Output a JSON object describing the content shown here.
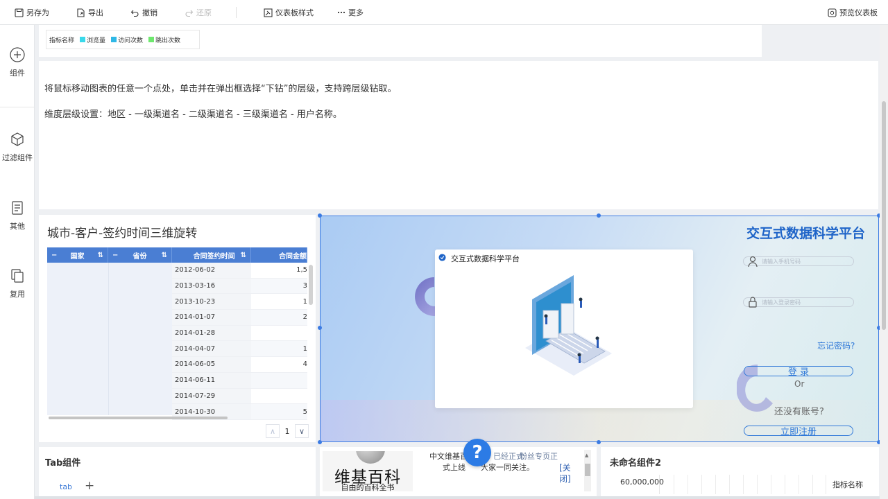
{
  "toolbar": {
    "save_as": "另存为",
    "export": "导出",
    "undo": "撤销",
    "redo": "还原",
    "dashboard_style": "仪表板样式",
    "more": "更多",
    "preview": "预览仪表板"
  },
  "sidebar": {
    "items": [
      {
        "label": "组件",
        "icon": "plus-circle-icon"
      },
      {
        "label": "过滤组件",
        "icon": "cube-icon"
      },
      {
        "label": "其他",
        "icon": "document-icon"
      },
      {
        "label": "复用",
        "icon": "copy-icon"
      }
    ]
  },
  "legend_panel": {
    "title": "指标名称",
    "items": [
      {
        "label": "浏览量",
        "color": "#3ad9ea"
      },
      {
        "label": "访问次数",
        "color": "#2fb8e6"
      },
      {
        "label": "跳出次数",
        "color": "#6ee86e"
      }
    ]
  },
  "text_panel": {
    "line1": "将鼠标移动图表的任意一个点处，单击并在弹出框选择“下钻”的层级，支持跨层级钻取。",
    "line2": "维度层级设置：地区 - 一级渠道名 - 二级渠道名 - 三级渠道名 - 用户名称。"
  },
  "table_widget": {
    "title": "城市-客户-签约时间三维旋转",
    "headers": [
      "国家",
      "省份",
      "合同签约时间",
      "合同金额"
    ],
    "collapse_symbol": "−",
    "sort_symbol": "⇅",
    "dates": [
      "2012-06-02",
      "2013-03-16",
      "2013-10-23",
      "2014-01-07",
      "2014-01-28",
      "2014-04-07",
      "2014-06-05",
      "2014-06-11",
      "2014-07-29",
      "2014-10-30"
    ],
    "amounts": [
      "1,5",
      "3",
      "1",
      "2",
      "",
      "1",
      "4",
      "",
      "",
      "5"
    ],
    "page": "1",
    "prev": "∧",
    "next": "∨"
  },
  "image_panel": {
    "dialog_title": "交互式数据科学平台",
    "brand_title": "交互式数据科学平台",
    "username_placeholder": "请输入手机号码",
    "password_placeholder": "请输入登录密码",
    "forgot": "忘记密码?",
    "login": "登 录",
    "or": "Or",
    "no_account": "还没有账号?",
    "register": "立即注册"
  },
  "tab_widget": {
    "title": "Tab组件",
    "tab": "tab",
    "add": "+"
  },
  "wiki_widget": {
    "logo_title": "维基百科",
    "logo_subtitle": "自由的百科全书",
    "line1": "中文维基百",
    "line1_overlap": "已经正式",
    "line1_right": "粉丝专页正",
    "line2": "式上线",
    "line2_right": "大家一同关注。",
    "close": "[关闭]"
  },
  "chart_widget": {
    "title": "未命名组件2",
    "y_tick": "60,000,000",
    "legend_title": "指标名称"
  },
  "help": "?"
}
